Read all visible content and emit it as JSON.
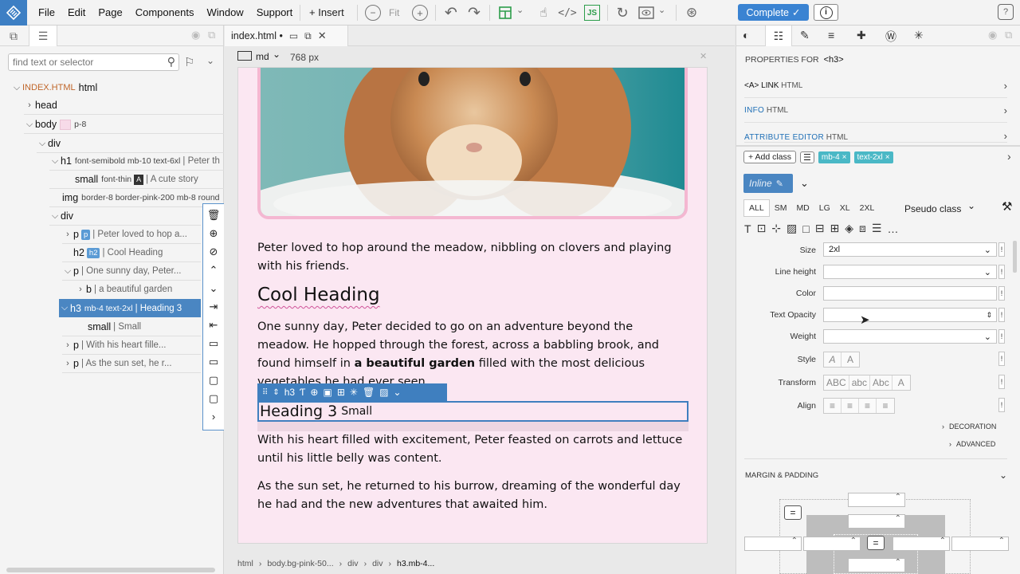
{
  "menu": [
    "File",
    "Edit",
    "Page",
    "Components",
    "Window",
    "Support"
  ],
  "toolbar": {
    "insert_label": "+ Insert",
    "fit_label": "Fit",
    "complete_label": "Complete"
  },
  "left": {
    "search_placeholder": "find text or selector",
    "tree": [
      {
        "tag": "INDEX.HTML",
        "cls": "html",
        "txt": ""
      },
      {
        "tag": "head",
        "cls": "",
        "txt": ""
      },
      {
        "tag": "body",
        "cls": "p-8",
        "txt": ""
      },
      {
        "tag": "div",
        "cls": "",
        "txt": ""
      },
      {
        "tag": "h1",
        "cls": "font-semibold mb-10 text-6xl",
        "txt": "| Peter th"
      },
      {
        "tag": "small",
        "cls": "font-thin",
        "txt": "| A cute story"
      },
      {
        "tag": "img",
        "cls": "border-8 border-pink-200 mb-8 round",
        "txt": ""
      },
      {
        "tag": "div",
        "cls": "",
        "txt": ""
      },
      {
        "tag": "p",
        "cls": "p",
        "txt": "| Peter loved to hop a..."
      },
      {
        "tag": "h2",
        "cls": "h2",
        "txt": "| Cool Heading"
      },
      {
        "tag": "p",
        "cls": "",
        "txt": "| One sunny day, Peter..."
      },
      {
        "tag": "b",
        "cls": "",
        "txt": "| a beautiful garden"
      },
      {
        "tag": "h3",
        "cls": "mb-4 text-2xl",
        "txt": "| Heading 3"
      },
      {
        "tag": "small",
        "cls": "",
        "txt": "| Small"
      },
      {
        "tag": "p",
        "cls": "",
        "txt": "| With his heart fille..."
      },
      {
        "tag": "p",
        "cls": "",
        "txt": "| As the sun set, he r..."
      }
    ],
    "badge_a": "A"
  },
  "doc": {
    "tab_name": "index.html •",
    "viewport_label": "md",
    "viewport_width": "768 px",
    "p1": "Peter loved to hop around the meadow, nibbling on clovers and playing with his friends.",
    "h2": "Cool Heading",
    "p2_a": "One sunny day, Peter decided to go on an adventure beyond the meadow. He hopped through the forest, across a babbling brook, and found himself in ",
    "p2_b": "a beautiful garden",
    "p2_c": " filled with the most delicious vegetables he had ever seen.",
    "h3_tag": "h3",
    "h3_text": "Heading 3",
    "h3_small": "Small",
    "p3": "With his heart filled with excitement, Peter feasted on carrots and lettuce until his little belly was content.",
    "p4": "As the sun set, he returned to his burrow, dreaming of the wonderful day he had and the new adventures that awaited him.",
    "breadcrumb": [
      "html",
      "body.bg-pink-50...",
      "div",
      "div",
      "h3.mb-4..."
    ]
  },
  "right": {
    "properties_for": "PROPERTIES FOR",
    "selected_tag": "<h3>",
    "accordions": [
      {
        "k": "<A> LINK",
        "l": "HTML"
      },
      {
        "k": "INFO",
        "l": "HTML"
      },
      {
        "k": "ATTRIBUTE EDITOR",
        "l": "HTML"
      }
    ],
    "add_class": "+ Add class",
    "classes": [
      "mb-4",
      "text-2xl"
    ],
    "inline_label": "Inline",
    "breakpoints": [
      "ALL",
      "SM",
      "MD",
      "LG",
      "XL",
      "2XL"
    ],
    "pseudo_label": "Pseudo class",
    "props": {
      "size_label": "Size",
      "size_value": "2xl",
      "line_height_label": "Line height",
      "color_label": "Color",
      "text_opacity_label": "Text Opacity",
      "weight_label": "Weight",
      "style_label": "Style",
      "transform_label": "Transform",
      "align_label": "Align"
    },
    "transform_options": [
      "ABC",
      "abc",
      "Abc",
      "A"
    ],
    "decoration_label": "DECORATION",
    "advanced_label": "ADVANCED",
    "margin_padding_label": "MARGIN & PADDING"
  },
  "colors": {
    "accent": "#3a83d2",
    "canvas_bg": "#fbe7f2",
    "selection": "#4a86c2",
    "chip": "#4ab8c6"
  }
}
